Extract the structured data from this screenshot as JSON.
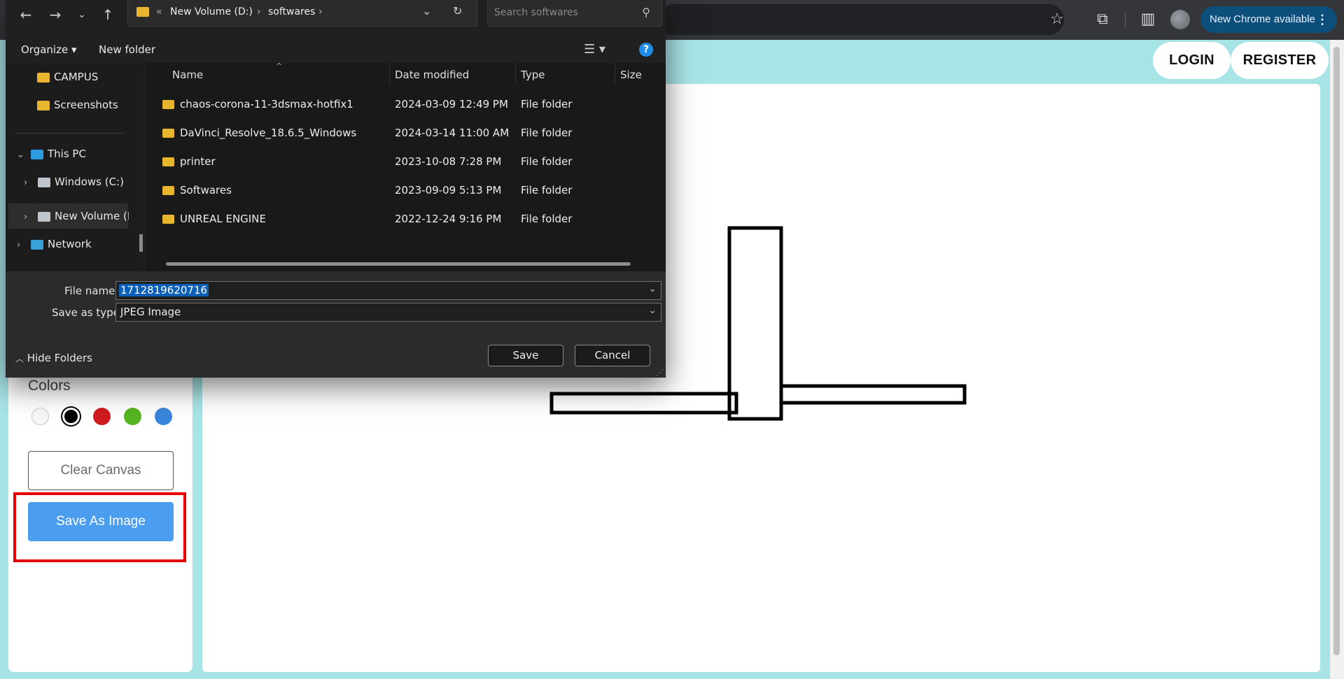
{
  "browser": {
    "update_label": "New Chrome available",
    "icons": [
      "star-icon",
      "extensions-icon",
      "side-panel-icon",
      "profile-icon",
      "more-icon"
    ]
  },
  "site": {
    "nav": {
      "login": "LOGIN",
      "register": "REGISTER"
    },
    "tools": {
      "colors_title": "Colors",
      "swatches": [
        "#e8e8e8",
        "#000000",
        "#d01c1f",
        "#55b520",
        "#3a86dc"
      ],
      "selected_swatch_index": 1,
      "clear_label": "Clear Canvas",
      "save_label": "Save As Image"
    },
    "colors": {
      "page_bg": "#a7e4e6",
      "accent_button": "#4b9df0",
      "highlight": "#e60000"
    }
  },
  "dialog": {
    "address": {
      "prefix": "«",
      "crumbs": [
        "New Volume (D:)",
        "softwares"
      ]
    },
    "search_placeholder": "Search softwares",
    "commands": {
      "organize": "Organize ▾",
      "new_folder": "New folder",
      "help": "?"
    },
    "nav_pane": [
      {
        "label": "CAMPUS",
        "icon": "folder-icon"
      },
      {
        "label": "Screenshots",
        "icon": "folder-icon"
      },
      {
        "label": "This PC",
        "icon": "pc-icon"
      },
      {
        "label": "Windows (C:)",
        "icon": "drive-icon"
      },
      {
        "label": "New Volume (D:)",
        "icon": "drive-icon"
      },
      {
        "label": "Network",
        "icon": "network-icon"
      }
    ],
    "columns": [
      "Name",
      "Date modified",
      "Type",
      "Size"
    ],
    "files": [
      {
        "name": "chaos-corona-11-3dsmax-hotfix1",
        "date": "2024-03-09 12:49 PM",
        "type": "File folder"
      },
      {
        "name": "DaVinci_Resolve_18.6.5_Windows",
        "date": "2024-03-14 11:00 AM",
        "type": "File folder"
      },
      {
        "name": "printer",
        "date": "2023-10-08 7:28 PM",
        "type": "File folder"
      },
      {
        "name": "Softwares",
        "date": "2023-09-09 5:13 PM",
        "type": "File folder"
      },
      {
        "name": "UNREAL ENGINE",
        "date": "2022-12-24 9:16 PM",
        "type": "File folder"
      }
    ],
    "file_name_label": "File name:",
    "file_name_value": "1712819620716",
    "save_type_label": "Save as type:",
    "save_type_value": "JPEG Image",
    "hide_folders": "Hide Folders",
    "save": "Save",
    "cancel": "Cancel"
  }
}
